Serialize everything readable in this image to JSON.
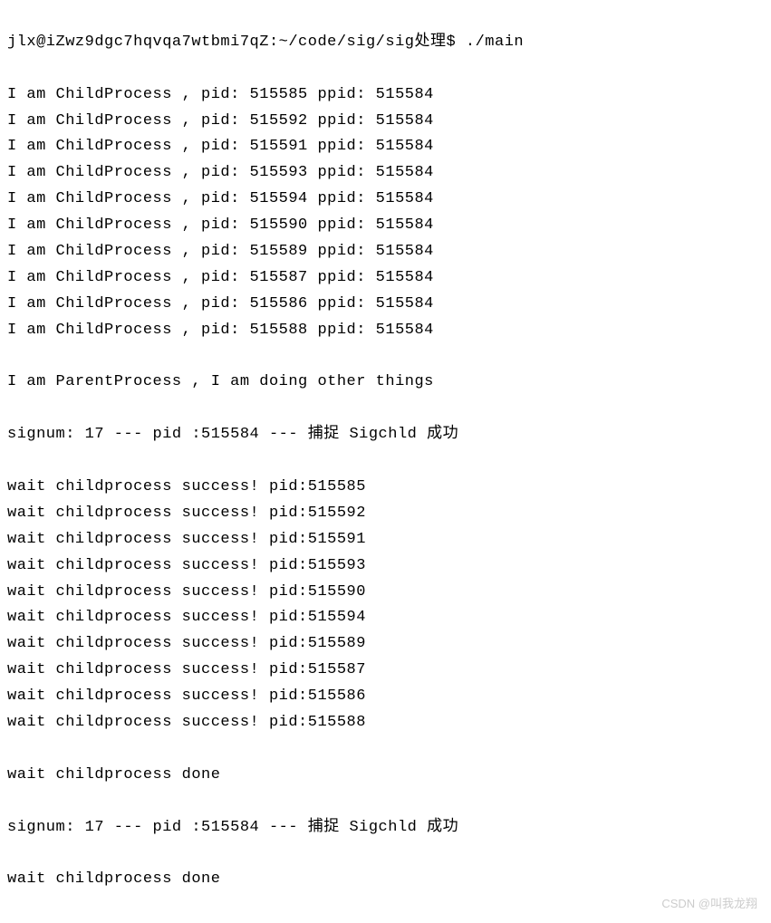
{
  "prompt": {
    "user_host_path": "jlx@iZwz9dgc7hqvqa7wtbmi7qZ:~/code/sig/sig处理",
    "symbol": "$",
    "command": "./main"
  },
  "children": [
    {
      "pid": "515585",
      "ppid": "515584"
    },
    {
      "pid": "515592",
      "ppid": "515584"
    },
    {
      "pid": "515591",
      "ppid": "515584"
    },
    {
      "pid": "515593",
      "ppid": "515584"
    },
    {
      "pid": "515594",
      "ppid": "515584"
    },
    {
      "pid": "515590",
      "ppid": "515584"
    },
    {
      "pid": "515589",
      "ppid": "515584"
    },
    {
      "pid": "515587",
      "ppid": "515584"
    },
    {
      "pid": "515586",
      "ppid": "515584"
    },
    {
      "pid": "515588",
      "ppid": "515584"
    }
  ],
  "child_prefix": "I am ChildProcess , pid: ",
  "child_ppid_label": " ppid: ",
  "parent_line": "I am ParentProcess , I am doing other things",
  "sigchld_line_1": "signum: 17 --- pid :515584 --- 捕捉 Sigchld 成功",
  "wait_prefix": "wait childprocess success! pid:",
  "wait_pids": [
    "515585",
    "515592",
    "515591",
    "515593",
    "515590",
    "515594",
    "515589",
    "515587",
    "515586",
    "515588"
  ],
  "wait_done": "wait childprocess done",
  "sigchld_line_2": "signum: 17 --- pid :515584 --- 捕捉 Sigchld 成功",
  "wait_done_2": "wait childprocess done",
  "watermark": "CSDN @叫我龙翔"
}
